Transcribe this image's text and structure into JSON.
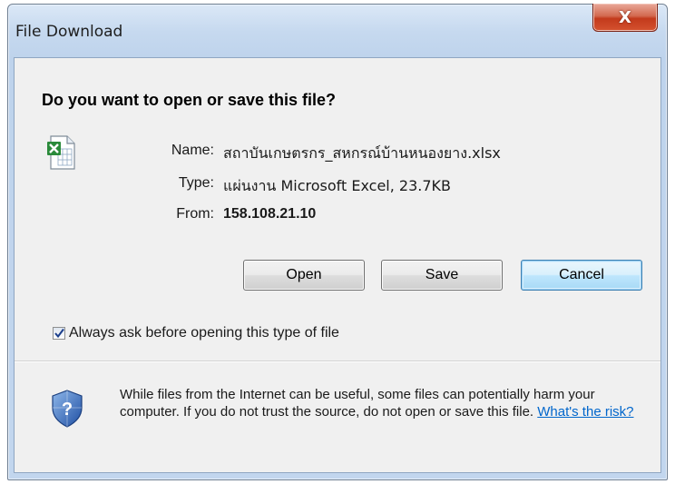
{
  "window": {
    "title": "File Download",
    "close_glyph": "X"
  },
  "dialog": {
    "question": "Do you want to open or save this file?",
    "file_icon": "excel-file-icon",
    "fields": [
      {
        "label": "Name:",
        "value": "สถาบันเกษตรกร_สหกรณ์บ้านหนองยาง.xlsx"
      },
      {
        "label": "Type:",
        "value": "แผ่นงาน Microsoft Excel, 23.7KB"
      },
      {
        "label": "From:",
        "value": "158.108.21.10"
      }
    ],
    "buttons": {
      "open": "Open",
      "save": "Save",
      "cancel": "Cancel"
    },
    "always_ask": {
      "label": "Always ask before opening this type of file",
      "checked": true
    }
  },
  "warning": {
    "icon": "security-shield-icon",
    "text": "While files from the Internet can be useful, some files can potentially harm your computer. If you do not trust the source, do not open or save this file.",
    "link_label": "What's the risk?"
  },
  "colors": {
    "link": "#0066cc",
    "close_button": "#c33a1c",
    "default_button_border": "#3c7fb1"
  }
}
